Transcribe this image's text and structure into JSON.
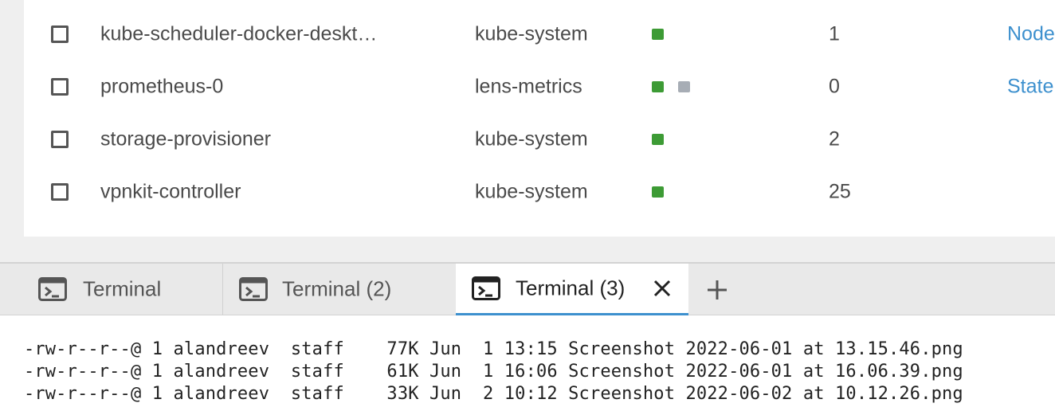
{
  "pods": [
    {
      "name": "kube-scheduler-docker-deskt…",
      "namespace": "kube-system",
      "containers": [
        "running"
      ],
      "restarts": "1",
      "owner": "Node"
    },
    {
      "name": "prometheus-0",
      "namespace": "lens-metrics",
      "containers": [
        "running",
        "waiting"
      ],
      "restarts": "0",
      "owner": "State"
    },
    {
      "name": "storage-provisioner",
      "namespace": "kube-system",
      "containers": [
        "running"
      ],
      "restarts": "2",
      "owner": ""
    },
    {
      "name": "vpnkit-controller",
      "namespace": "kube-system",
      "containers": [
        "running"
      ],
      "restarts": "25",
      "owner": ""
    }
  ],
  "colors": {
    "running": "#3d9b35",
    "waiting": "#a7adb5",
    "accent": "#3d90ce"
  },
  "dock": {
    "tabs": [
      {
        "label": "Terminal",
        "icon": "terminal-icon",
        "active": false
      },
      {
        "label": "Terminal (2)",
        "icon": "terminal-icon",
        "active": false
      },
      {
        "label": "Terminal (3)",
        "icon": "terminal-icon",
        "active": true
      }
    ],
    "close_icon": "close-icon",
    "add_icon": "plus-icon"
  },
  "terminal": {
    "lines": [
      "-rw-r--r--@ 1 alandreev  staff    77K Jun  1 13:15 Screenshot 2022-06-01 at 13.15.46.png",
      "-rw-r--r--@ 1 alandreev  staff    61K Jun  1 16:06 Screenshot 2022-06-01 at 16.06.39.png",
      "-rw-r--r--@ 1 alandreev  staff    33K Jun  2 10:12 Screenshot 2022-06-02 at 10.12.26.png"
    ]
  }
}
